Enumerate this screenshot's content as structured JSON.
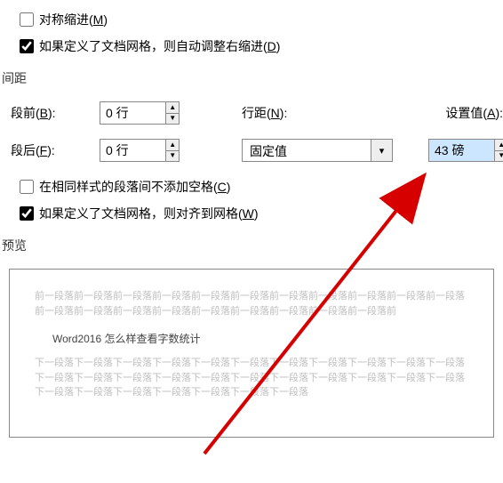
{
  "mirror_indent": {
    "checked": false,
    "label": "对称缩进(",
    "accel": "M",
    "label_end": ")"
  },
  "auto_adjust": {
    "checked": true,
    "label": "如果定义了文档网格，则自动调整右缩进(",
    "accel": "D",
    "label_end": ")"
  },
  "spacing_header": "间距",
  "before": {
    "label": "段前(",
    "accel": "B",
    "label_end": "):",
    "value": "0 行"
  },
  "after": {
    "label": "段后(",
    "accel": "F",
    "label_end": "):",
    "value": "0 行"
  },
  "line_spacing": {
    "label": "行距(",
    "accel": "N",
    "label_end": "):",
    "value": "固定值"
  },
  "set_at": {
    "label": "设置值(",
    "accel": "A",
    "label_end": "):",
    "value": "43 磅"
  },
  "no_space_same_style": {
    "checked": false,
    "label": "在相同样式的段落间不添加空格(",
    "accel": "C",
    "label_end": ")"
  },
  "snap_grid": {
    "checked": true,
    "label": "如果定义了文档网格，则对齐到网格(",
    "accel": "W",
    "label_end": ")"
  },
  "preview_header": "预览",
  "preview": {
    "before_text": "前一段落前一段落前一段落前一段落前一段落前一段落前一段落前一段落前一段落前一段落前一段落前一段落前一段落前一段落前一段落前一段落前一段落前一段落前一段落前一段落前",
    "sample": "Word2016 怎么样查看字数统计",
    "after_text": "下一段落下一段落下一段落下一段落下一段落下一段落下一段落下一段落下一段落下一段落下一段落下一段落下一段落下一段落下一段落下一段落下一段落下一段落下一段落下一段落下一段落下一段落下一段落下一段落下一段落下一段落下一段落下一段落下一段落"
  }
}
